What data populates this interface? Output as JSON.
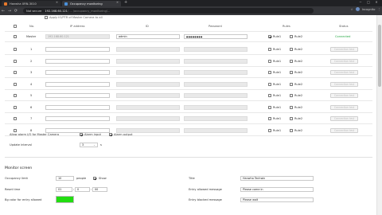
{
  "browser": {
    "tabs": [
      {
        "title": "Hanwha XRN-3010"
      },
      {
        "title": "Occupancy monitoring"
      }
    ],
    "new_tab": "+",
    "security": "Not secure",
    "url": "192.168.60.121",
    "url_rest": "/ ... /occupancy_monitoring/...",
    "profile": "Incognito"
  },
  "top": {
    "partial_text": "Apply IO/PTR of Master Camera to all"
  },
  "table": {
    "headers": {
      "no": "No.",
      "ip": "IP address",
      "id": "ID",
      "password": "Password",
      "rules": "Rules",
      "status": "Status"
    },
    "master": {
      "label": "Master",
      "ip": "192.168.60.121",
      "id": "admin",
      "password": "●●●●●●●●",
      "rule1": "Rule1",
      "rule2": "Rule2",
      "status": "Connected"
    },
    "rows": [
      {
        "no": "1",
        "rule1": "Rule1",
        "rule2": "Rule2",
        "button": "Connection test"
      },
      {
        "no": "2",
        "rule1": "Rule1",
        "rule2": "Rule2",
        "button": "Connection test"
      },
      {
        "no": "3",
        "rule1": "Rule1",
        "rule2": "Rule2",
        "button": "Connection test"
      },
      {
        "no": "4",
        "rule1": "Rule1",
        "rule2": "Rule2",
        "button": "Connection test"
      },
      {
        "no": "5",
        "rule1": "Rule1",
        "rule2": "Rule2",
        "button": "Connection test"
      },
      {
        "no": "6",
        "rule1": "Rule1",
        "rule2": "Rule2",
        "button": "Connection test"
      },
      {
        "no": "7",
        "rule1": "Rule1",
        "rule2": "Rule2",
        "button": "Connection test"
      },
      {
        "no": "8",
        "rule1": "Rule1",
        "rule2": "Rule2",
        "button": "Connection test"
      }
    ]
  },
  "alarm": {
    "label": "Allow alarm I/O for Master Camera",
    "alarm_input": "Alarm input",
    "alarm_output": "Alarm output"
  },
  "update": {
    "label": "Update interval",
    "value": "3",
    "unit": "s"
  },
  "monitor": {
    "heading": "Monitor screen",
    "occupancy_label": "Occupancy limit",
    "occupancy_value": "10",
    "occupancy_unit": "people",
    "show_label": "Show",
    "reset_label": "Reset time",
    "reset_h": "01",
    "reset_m": "0",
    "reset_s": "00",
    "bg_label": "Bg color for entry allowed",
    "bg_color": "#22dd11",
    "title_label": "Title",
    "title_value": "Hanwha Techwin",
    "allowed_label": "Entry allowed message",
    "allowed_value": "Please come in",
    "blocked_label": "Entry blocked message",
    "blocked_value": "Please wait"
  }
}
